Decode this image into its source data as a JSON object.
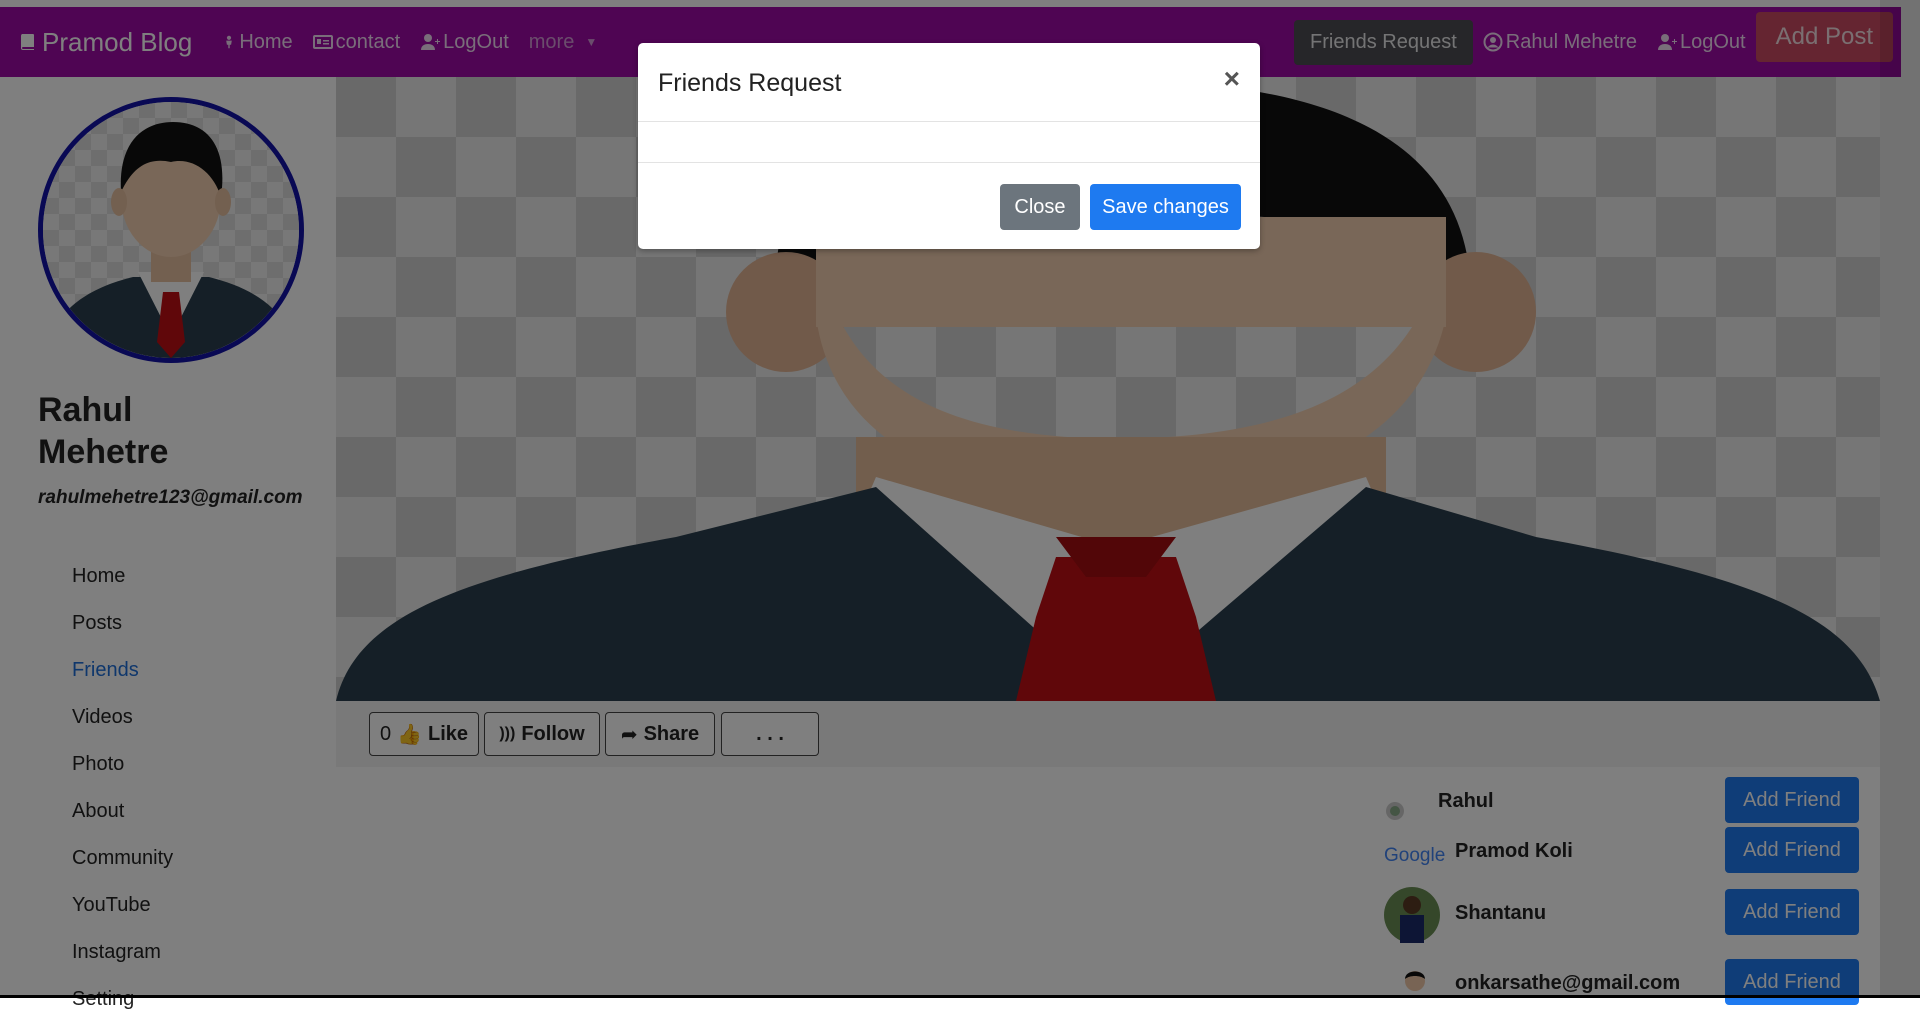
{
  "navbar": {
    "brand": "Pramod Blog",
    "links": [
      "Home",
      "contact",
      "LogOut"
    ],
    "more": "more",
    "friends_request": "Friends Request",
    "user": "Rahul Mehetre",
    "logout": "LogOut",
    "add_post": "Add Post",
    "color": "#9f0aa6"
  },
  "profile": {
    "name_line1": "Rahul",
    "name_line2": "Mehetre",
    "email": "rahulmehetre123@gmail.com"
  },
  "menu": {
    "items": [
      "Home",
      "Posts",
      "Friends",
      "Videos",
      "Photo",
      "About",
      "Community",
      "YouTube",
      "Instagram",
      "Setting"
    ],
    "active": "Friends"
  },
  "actions": {
    "like_count": "0",
    "like": "Like",
    "follow": "Follow",
    "share": "Share",
    "more": ". . ."
  },
  "friends": [
    {
      "name": "Rahul",
      "button": "Add Friend"
    },
    {
      "name": "Pramod Koli",
      "button": "Add Friend"
    },
    {
      "name": "Shantanu",
      "button": "Add Friend"
    },
    {
      "name": "onkarsathe@gmail.com",
      "button": "Add Friend"
    }
  ],
  "modal": {
    "title": "Friends Request",
    "close_x": "×",
    "close_button": "Close",
    "save_button": "Save changes"
  }
}
